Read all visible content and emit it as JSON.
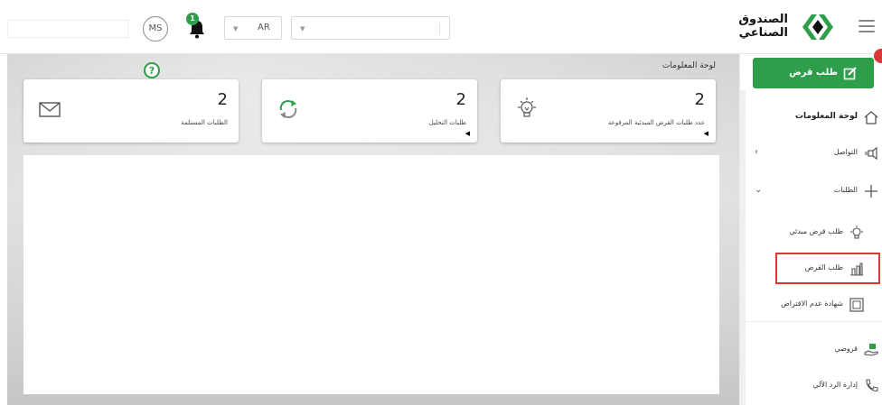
{
  "header": {
    "avatar_initials": "MS",
    "notification_count": "1",
    "language": "AR",
    "logo_line1": "الصندوق",
    "logo_line2": "الصناعي"
  },
  "dashboard": {
    "breadcrumb": "لوحة المعلومات",
    "cards": [
      {
        "count": "2",
        "label": "عدد طلبات القرض المبدئية المرفوعة",
        "icon": "lightbulb-icon"
      },
      {
        "count": "2",
        "label": "طلبات التحليل",
        "icon": "refresh-icon"
      },
      {
        "count": "2",
        "label": "الطلبات المستلمة",
        "icon": "envelope-icon"
      }
    ]
  },
  "sidebar": {
    "new_loan_label": "طلب قرض",
    "items": [
      {
        "label": "لوحة المعلومات",
        "icon": "home-icon"
      },
      {
        "label": "التواصل",
        "icon": "megaphone-icon"
      },
      {
        "label": "الطلبات",
        "icon": "plus-icon"
      },
      {
        "label": "طلب قرض مبدئي",
        "icon": "lightbulb-icon"
      },
      {
        "label": "طلب القرض",
        "icon": "factory-chart-icon"
      },
      {
        "label": "شهادة عدم الاقتراض",
        "icon": "certificate-icon"
      },
      {
        "label": "قروضي",
        "icon": "hand-money-icon"
      },
      {
        "label": "إدارة الرد الآلي",
        "icon": "phone-icon"
      }
    ]
  },
  "colors": {
    "brand_green": "#2e9e4a",
    "alert_red": "#d93838"
  }
}
